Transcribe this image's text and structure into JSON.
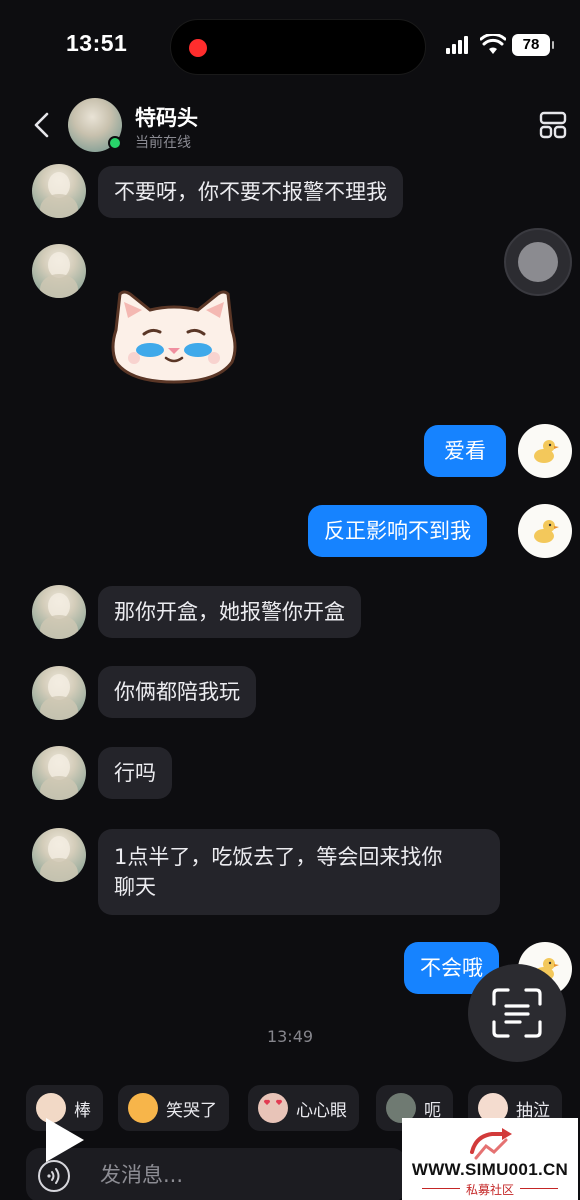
{
  "status_bar": {
    "time": "13:51",
    "battery": "78",
    "colors": {
      "recording": "#ff2d2d"
    }
  },
  "header": {
    "name": "特码头",
    "status": "当前在线",
    "icons": [
      "back-icon",
      "grid-icon"
    ]
  },
  "messages": [
    {
      "side": "in",
      "text": "不要呀，你不要不报警不理我"
    },
    {
      "side": "in",
      "sticker": "crying-cat-sticker"
    },
    {
      "side": "out",
      "text": "爱看"
    },
    {
      "side": "out",
      "text": "反正影响不到我"
    },
    {
      "side": "in",
      "text": "那你开盒，她报警你开盒"
    },
    {
      "side": "in",
      "text": "你俩都陪我玩"
    },
    {
      "side": "in",
      "text": "行吗"
    },
    {
      "side": "in",
      "text_line1": "1点半了，吃饭去了，等会回来找你",
      "text_line2": "聊天"
    },
    {
      "side": "out",
      "text": "不会哦"
    }
  ],
  "timestamp": "13:49",
  "quick_replies": [
    {
      "label": "棒",
      "icon": "cat-thumbs-icon"
    },
    {
      "label": "笑哭了",
      "icon": "cat-laughing-icon"
    },
    {
      "label": "心心眼",
      "icon": "cat-heart-eyes-icon"
    },
    {
      "label": "呃",
      "icon": "cat-grimace-icon"
    },
    {
      "label": "抽泣",
      "icon": "cat-sob-icon"
    }
  ],
  "input": {
    "placeholder": "发消息..."
  },
  "watermark": {
    "url": "WWW.SIMU001.CN",
    "subtitle": "私募社区"
  },
  "colors": {
    "background": "#0d0d10",
    "bubble_in": "#24242a",
    "bubble_out": "#1683ff",
    "online": "#28d36a"
  }
}
